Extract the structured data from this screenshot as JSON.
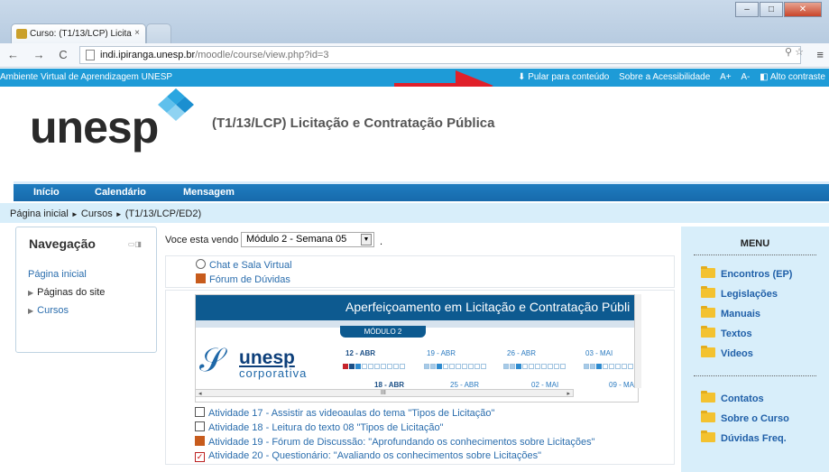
{
  "browser": {
    "tab_title": "Curso: (T1/13/LCP) Licita",
    "tab_close": "×",
    "url_host": "indi.ipiranga.unesp.br",
    "url_path": "/moodle/course/view.php?id=3",
    "nav_icons": "← → C"
  },
  "topbar": {
    "left_text": "Ambiente Virtual de Aprendizagem UNESP",
    "skip_link": "⬇ Pular para conteúdo",
    "accessibility": "Sobre a Acessibilidade",
    "font_up": "A+",
    "font_down": "A-",
    "contrast": "◧ Alto contraste"
  },
  "header": {
    "logo": "unesp",
    "course_title": "(T1/13/LCP) Licitação e Contratação Pública"
  },
  "mainnav": {
    "items": [
      "Início",
      "Calendário",
      "Mensagem"
    ]
  },
  "breadcrumb": {
    "home": "Página inicial",
    "sep": "►",
    "courses": "Cursos",
    "course": "(T1/13/LCP/ED2)"
  },
  "navigation": {
    "title": "Navegação",
    "home": "Página inicial",
    "site_pages": "Páginas do site",
    "courses": "Cursos"
  },
  "viewing": {
    "label": "Voce esta vendo",
    "selected": "Módulo 2 - Semana 05",
    "dot": "."
  },
  "section1": {
    "chat": "Chat e Sala Virtual",
    "forum": "Fórum de Dúvidas"
  },
  "banner": {
    "title": "Aperfeiçoamento em Licitação e Contratação Públi",
    "module": "MÓDULO 2",
    "logo": "unesp",
    "logo_sub": "corporativa",
    "dates_top": [
      "12 - ABR",
      "19 - ABR",
      "26 - ABR",
      "03 - MAI"
    ],
    "dates_bottom": [
      "18 - ABR",
      "25 - ABR",
      "02 - MAI",
      "09 - MA"
    ],
    "scroll_mark": "III"
  },
  "activities": [
    "Atividade 17 - Assistir as videoaulas do tema \"Tipos de Licitação\"",
    "Atividade 18 - Leitura do texto 08 \"Tipos de Licitação\"",
    "Atividade 19 - Fórum de Discussão: \"Aprofundando os conhecimentos sobre Licitações\"",
    "Atividade 20 - Questionário: \"Avaliando os conhecimentos sobre Licitações\""
  ],
  "menu": {
    "title": "MENU",
    "items_top": [
      "Encontros (EP)",
      "Legislações",
      "Manuais",
      "Textos",
      "Videos"
    ],
    "items_bottom": [
      "Contatos",
      "Sobre o Curso",
      "Dúvidas Freq."
    ]
  },
  "colors": {
    "accent_blue": "#1e9bd7",
    "nav_blue": "#1f7dc0",
    "light_panel": "#d8eefa",
    "annotation_red": "#e0202a"
  }
}
